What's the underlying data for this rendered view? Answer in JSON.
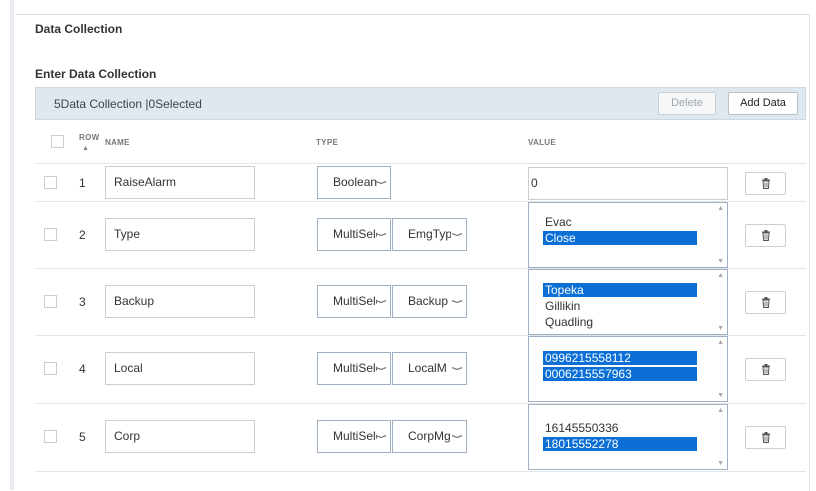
{
  "section_title": "Data Collection",
  "subsection_title": "Enter Data Collection",
  "toolbar": {
    "count_text": "5Data Collection |0Selected",
    "delete_label": "Delete",
    "add_label": "Add Data"
  },
  "columns": {
    "row": "ROW",
    "name": "NAME",
    "type": "TYPE",
    "value": "VALUE"
  },
  "rows": [
    {
      "num": "1",
      "name": "RaiseAlarm",
      "type": "Boolean",
      "subtype": "",
      "value": "0",
      "options": []
    },
    {
      "num": "2",
      "name": "Type",
      "type": "MultiSelect",
      "subtype": "EmgType",
      "options": [
        {
          "label": "Evac",
          "selected": false
        },
        {
          "label": "Close",
          "selected": true
        }
      ]
    },
    {
      "num": "3",
      "name": "Backup",
      "type": "MultiSelect",
      "subtype": "Backup",
      "options": [
        {
          "label": "Topeka",
          "selected": true
        },
        {
          "label": "Gillikin",
          "selected": false
        },
        {
          "label": "Quadling",
          "selected": false
        }
      ]
    },
    {
      "num": "4",
      "name": "Local",
      "type": "MultiSelect",
      "subtype": "LocalM",
      "options": [
        {
          "label": "0996215558112",
          "selected": true
        },
        {
          "label": "0006215557963",
          "selected": true
        }
      ]
    },
    {
      "num": "5",
      "name": "Corp",
      "type": "MultiSelect",
      "subtype": "CorpMg",
      "options": [
        {
          "label": "16145550336",
          "selected": false
        },
        {
          "label": "18015552278",
          "selected": true
        }
      ]
    }
  ],
  "colors": {
    "selected_option": "#0b6fd6",
    "toolbar_bg": "#dfe7ef"
  }
}
